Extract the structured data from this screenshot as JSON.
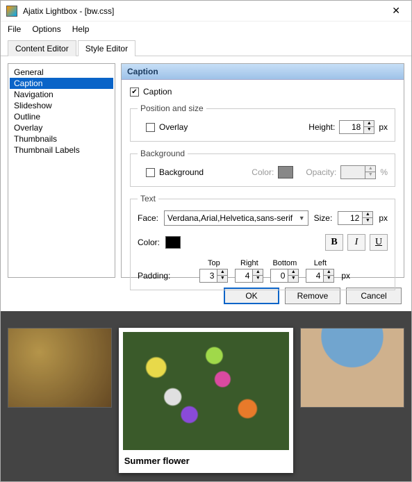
{
  "window": {
    "title": "Ajatix Lightbox - [bw.css]"
  },
  "menu": {
    "file": "File",
    "options": "Options",
    "help": "Help"
  },
  "tabs": {
    "content": "Content Editor",
    "style": "Style Editor"
  },
  "categories": [
    "General",
    "Caption",
    "Navigation",
    "Slideshow",
    "Outline",
    "Overlay",
    "Thumbnails",
    "Thumbnail Labels"
  ],
  "selected_category_index": 1,
  "pane": {
    "title": "Caption",
    "caption_checked": true,
    "caption_label": "Caption",
    "pos_size": {
      "legend": "Position and size",
      "overlay_label": "Overlay",
      "overlay_checked": false,
      "height_label": "Height:",
      "height_value": "18",
      "px": "px"
    },
    "background": {
      "legend": "Background",
      "bg_label": "Background",
      "bg_checked": false,
      "color_label": "Color:",
      "color_value": "#888888",
      "opacity_label": "Opacity:",
      "opacity_value": "",
      "pct": "%"
    },
    "text": {
      "legend": "Text",
      "face_label": "Face:",
      "face_value": "Verdana,Arial,Helvetica,sans-serif",
      "size_label": "Size:",
      "size_value": "12",
      "px": "px",
      "color_label": "Color:",
      "color_value": "#000000",
      "bold": "B",
      "italic": "I",
      "underline": "U",
      "padding_label": "Padding:",
      "top_label": "Top",
      "top_value": "3",
      "right_label": "Right",
      "right_value": "4",
      "bottom_label": "Bottom",
      "bottom_value": "0",
      "left_label": "Left",
      "left_value": "4",
      "pad_px": "px"
    }
  },
  "buttons": {
    "ok": "OK",
    "remove": "Remove",
    "cancel": "Cancel"
  },
  "preview": {
    "caption": "Summer flower"
  }
}
